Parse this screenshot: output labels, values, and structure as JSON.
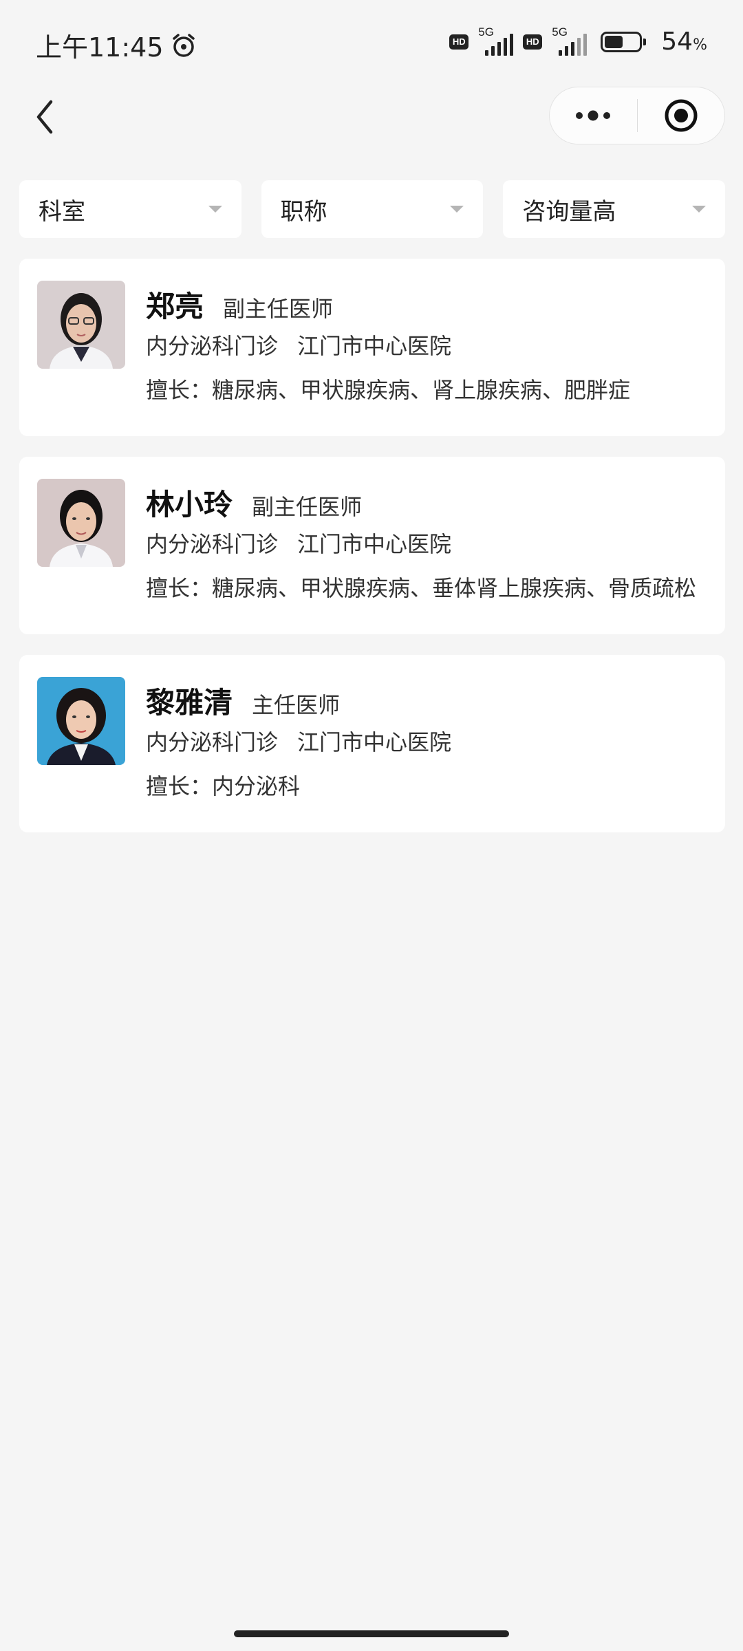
{
  "status_bar": {
    "time": "上午11:45",
    "network1_label": "5G",
    "network2_label": "5G",
    "hd_label": "HD",
    "battery_level": 54,
    "battery_text": "54",
    "battery_unit": "%"
  },
  "filters": [
    {
      "label": "科室"
    },
    {
      "label": "职称"
    },
    {
      "label": "咨询量高"
    }
  ],
  "doctors": [
    {
      "name": "郑亮",
      "title": "副主任医师",
      "department": "内分泌科门诊",
      "hospital": "江门市中心医院",
      "skills": "擅长：糖尿病、甲状腺疾病、肾上腺疾病、肥胖症",
      "avatar_bg": "#d8cfd0"
    },
    {
      "name": "林小玲",
      "title": "副主任医师",
      "department": "内分泌科门诊",
      "hospital": "江门市中心医院",
      "skills": "擅长：糖尿病、甲状腺疾病、垂体肾上腺疾病、骨质疏松",
      "avatar_bg": "#d6c8c8"
    },
    {
      "name": "黎雅清",
      "title": "主任医师",
      "department": "内分泌科门诊",
      "hospital": "江门市中心医院",
      "skills": "擅长：内分泌科",
      "avatar_bg": "#3aa3d6"
    }
  ]
}
